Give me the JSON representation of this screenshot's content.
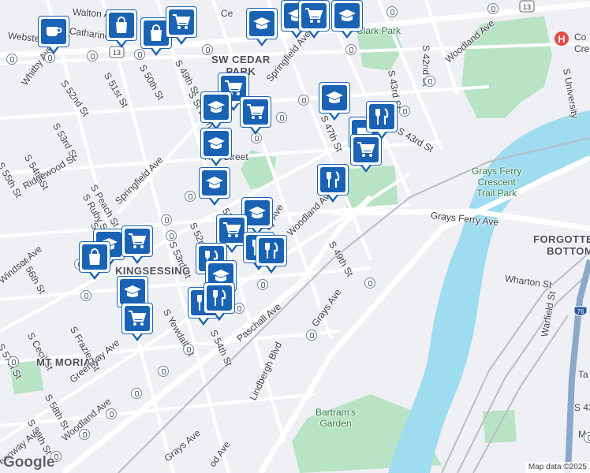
{
  "map": {
    "water_color": "#9fdcf0",
    "park_color": "#b9e3c5",
    "marker_color": "#1a62b4",
    "labels": {
      "walton": "Walton Ave",
      "catharine": "Catharine",
      "webster": "Webster",
      "whitby": "Whitby Ave",
      "s52nd_a": "S 52nd St",
      "s51st_a": "S 51st St",
      "s50th_a": "S 50th St",
      "s49th_a": "S 49th St",
      "st_bern": "S St Bern",
      "sw_cedar_park": "SW CEDAR\nPARK",
      "springfield_a": "Springfield Ave",
      "clark_park": "Clark Park",
      "s42nd": "S 42nd St",
      "s43rd_a": "S 43rd St",
      "woodland_a": "Woodland Ave",
      "s53rd_a": "S 53rd St",
      "s54th_a": "S 54th St",
      "s55th_a": "S 55th St",
      "ridgewood": "Ridgewood St",
      "s47th": "S 47th St",
      "s43rd_b": "S 43rd St",
      "street_47": "47th Street",
      "grays_ferry_park": "Grays Ferry\nCrescent\nTrail Park",
      "grays_ferry_ave": "Grays Ferry Ave",
      "forgotten_bottom": "FORGOTTE\nBOTTOM",
      "peach": "S Peach St",
      "ruby": "S Ruby St",
      "springfield_b": "Springfield Ave",
      "s54th_b": "S 54th St",
      "s52nd_b": "S 52nd St",
      "s51st_b": "51st St",
      "woodland_b": "Woodland Ave",
      "s49th_b": "S 49th St",
      "s56th": "S 56th St",
      "s53rd_b": "S 53rd St",
      "ay_ave": "ay Ave",
      "windsor": "Windsor Ave",
      "kingsessing": "KINGSESSING",
      "wharton": "Wharton St",
      "yewdall": "S Yewdall St",
      "frazier": "S Frazier St",
      "cecil": "S Cecil St",
      "s57th": "S 57th St",
      "paschall": "Paschall Ave",
      "s54th_c": "S 54th St",
      "grays_ave_a": "Grays Ave",
      "mt_moriah": "MT MORIAH",
      "greenway_a": "Greenway Ave",
      "s58th": "S 58th St",
      "lindbergh": "Lindbergh Blvd",
      "warfield": "Warfield St",
      "s59th": "S 59th St",
      "woodland_c": "Woodland Ave",
      "bartrams": "Bartram's\nGarden",
      "greenway_b": "eenway Ave",
      "grays_ave_b": "Grays Ave",
      "od_ave": "od Ave",
      "university": "S University",
      "ce": "Ce",
      "co": "Co",
      "cre": "Cre",
      "ta": "Ta",
      "s43_partial": "S 43",
      "ma": "Ma"
    },
    "route_shield": "13",
    "interstate_shield": "76",
    "hospital_glyph": "H",
    "markers": [
      {
        "icon": "coffee"
      },
      {
        "icon": "shopping-bag"
      },
      {
        "icon": "shopping-bag"
      },
      {
        "icon": "shopping-cart"
      },
      {
        "icon": "school"
      },
      {
        "icon": "school"
      },
      {
        "icon": "shopping-cart"
      },
      {
        "icon": "school"
      },
      {
        "icon": "shopping-cart"
      },
      {
        "icon": "school"
      },
      {
        "icon": "shopping-cart"
      },
      {
        "icon": "school"
      },
      {
        "icon": "school"
      },
      {
        "icon": "restaurant"
      },
      {
        "icon": "coffee"
      },
      {
        "icon": "shopping-cart"
      },
      {
        "icon": "restaurant"
      },
      {
        "icon": "school"
      },
      {
        "icon": "school"
      },
      {
        "icon": "shopping-cart"
      },
      {
        "icon": "restaurant"
      },
      {
        "icon": "restaurant"
      },
      {
        "icon": "school"
      },
      {
        "icon": "shopping-cart"
      },
      {
        "icon": "shopping-bag"
      },
      {
        "icon": "restaurant"
      },
      {
        "icon": "school"
      },
      {
        "icon": "restaurant"
      },
      {
        "icon": "restaurant"
      },
      {
        "icon": "school"
      },
      {
        "icon": "shopping-cart"
      }
    ]
  },
  "footer": {
    "logo": "Google",
    "attribution": "Map data ©2025"
  }
}
